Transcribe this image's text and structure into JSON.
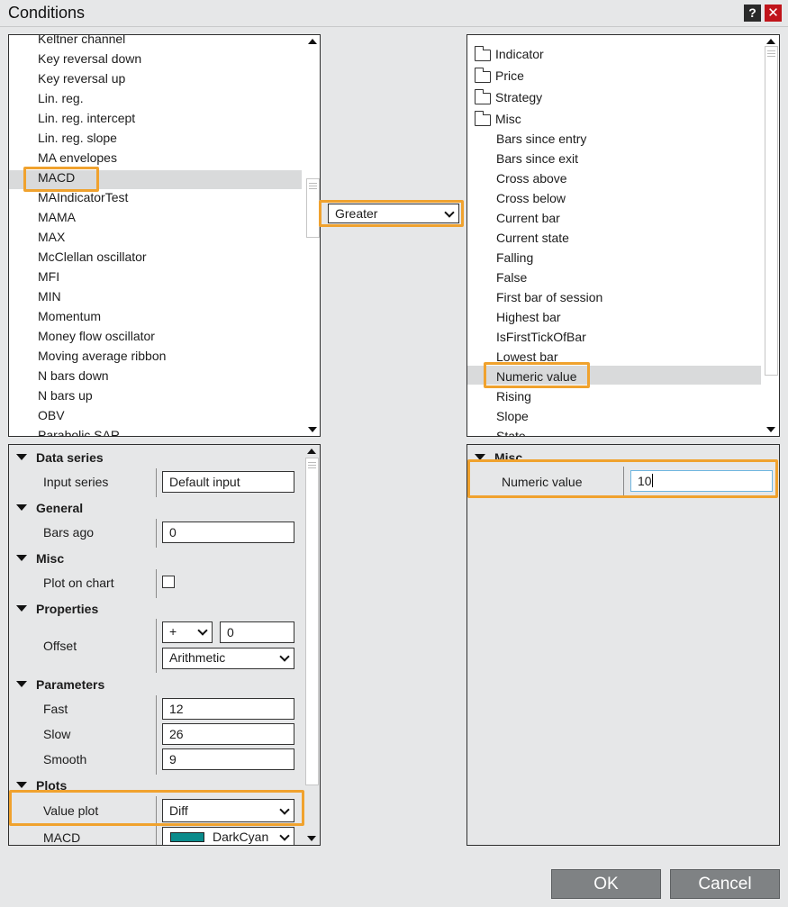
{
  "dialog": {
    "title": "Conditions",
    "help_label": "?",
    "close_label": "✕"
  },
  "left_list": {
    "items": [
      "Keltner channel",
      "Key reversal down",
      "Key reversal up",
      "Lin. reg.",
      "Lin. reg. intercept",
      "Lin. reg. slope",
      "MA envelopes",
      "MACD",
      "MAIndicatorTest",
      "MAMA",
      "MAX",
      "McClellan oscillator",
      "MFI",
      "MIN",
      "Momentum",
      "Money flow oscillator",
      "Moving average ribbon",
      "N bars down",
      "N bars up",
      "OBV",
      "Parabolic SAR"
    ],
    "selected": "MACD"
  },
  "operator": {
    "selected": "Greater"
  },
  "right_tree": {
    "folders": [
      "Indicator",
      "Price",
      "Strategy",
      "Misc"
    ],
    "misc_items": [
      "Bars since entry",
      "Bars since exit",
      "Cross above",
      "Cross below",
      "Current bar",
      "Current state",
      "Falling",
      "False",
      "First bar of session",
      "Highest bar",
      "IsFirstTickOfBar",
      "Lowest bar",
      "Numeric value",
      "Rising",
      "Slope",
      "State"
    ],
    "selected": "Numeric value"
  },
  "left_props": {
    "data_series": {
      "header": "Data series",
      "input_series_label": "Input series",
      "input_series_value": "Default input"
    },
    "general": {
      "header": "General",
      "bars_ago_label": "Bars ago",
      "bars_ago_value": "0"
    },
    "misc": {
      "header": "Misc",
      "plot_on_chart_label": "Plot on chart",
      "plot_on_chart_checked": false
    },
    "properties": {
      "header": "Properties",
      "offset_label": "Offset",
      "offset_sign": "+",
      "offset_value": "0",
      "offset_type": "Arithmetic"
    },
    "parameters": {
      "header": "Parameters",
      "fast_label": "Fast",
      "fast_value": "12",
      "slow_label": "Slow",
      "slow_value": "26",
      "smooth_label": "Smooth",
      "smooth_value": "9"
    },
    "plots": {
      "header": "Plots",
      "value_plot_label": "Value plot",
      "value_plot_value": "Diff",
      "macd_label": "MACD",
      "macd_color_name": "DarkCyan",
      "macd_color": "#0b8b8b"
    }
  },
  "right_props": {
    "misc": {
      "header": "Misc",
      "numeric_value_label": "Numeric value",
      "numeric_value": "10"
    }
  },
  "buttons": {
    "ok": "OK",
    "cancel": "Cancel"
  },
  "colors": {
    "highlight": "#f0a22e",
    "button_bg": "#7f8284",
    "close_red": "#c0141a"
  }
}
